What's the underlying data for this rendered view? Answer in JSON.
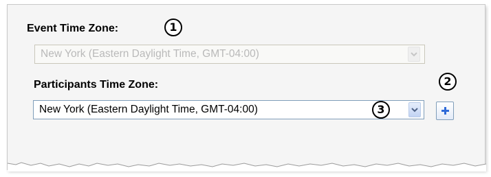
{
  "event_time_zone": {
    "label": "Event Time Zone:",
    "value": "New York (Eastern Daylight Time, GMT-04:00)",
    "disabled": true
  },
  "participants_time_zone": {
    "label": "Participants Time Zone:",
    "value": "New York (Eastern Daylight Time, GMT-04:00)"
  },
  "callouts": [
    "1",
    "2",
    "3"
  ],
  "icons": {
    "dropdown": "chevron-down-icon",
    "add": "plus-icon"
  },
  "colors": {
    "panel_background": "#f5f5f5",
    "field_border": "#7f9db9",
    "disabled_text": "#b9b9b9",
    "plus_icon": "#2e6ad8"
  }
}
